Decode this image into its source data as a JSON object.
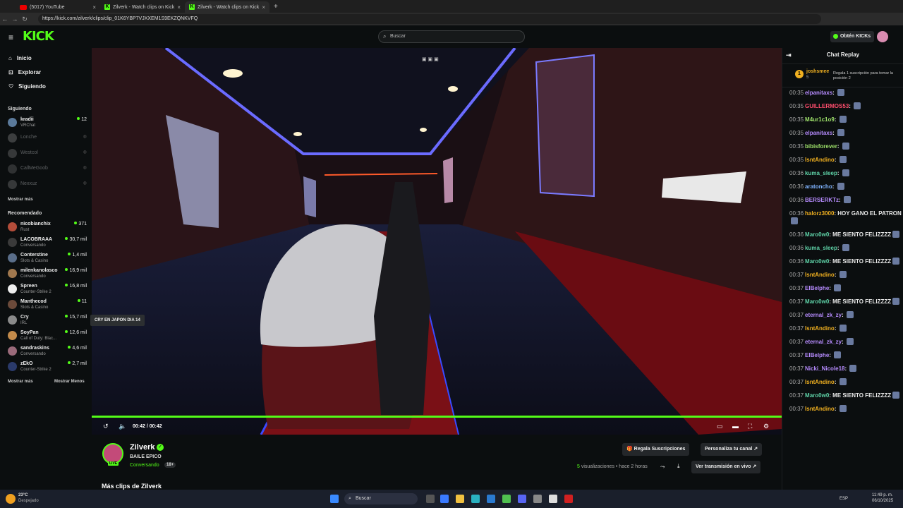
{
  "browser": {
    "tabs": [
      {
        "title": "(5017) YouTube",
        "icon": "youtube-icon"
      },
      {
        "title": "Zilverk - Watch clips on Kick",
        "icon": "kick-icon"
      },
      {
        "title": "Zilverk - Watch clips on Kick",
        "icon": "kick-icon"
      }
    ],
    "url": "https://kick.com/zilverk/clips/clip_01K6YBP7VJXXEM1S9EKZQNKVFQ"
  },
  "topnav": {
    "logo": "KICK",
    "search_placeholder": "Buscar",
    "kicks_button": "Obtén KICKs"
  },
  "sidebar": {
    "main_links": [
      {
        "label": "Inicio",
        "icon": "home-icon"
      },
      {
        "label": "Explorar",
        "icon": "compass-icon"
      },
      {
        "label": "Siguiendo",
        "icon": "heart-icon"
      }
    ],
    "following_title": "Siguiendo",
    "following": [
      {
        "name": "kradii",
        "sub": "VRChat",
        "viewers": "12",
        "online": true,
        "color": "#5b7a9b"
      },
      {
        "name": "Lonche",
        "online": false,
        "color": "#888888"
      },
      {
        "name": "Westcol",
        "online": false,
        "color": "#777777"
      },
      {
        "name": "CallMeGoob",
        "online": false,
        "color": "#666666"
      },
      {
        "name": "Nexxuz",
        "online": false,
        "color": "#777777"
      }
    ],
    "show_more": "Mostrar más",
    "recommended_title": "Recomendado",
    "recommended": [
      {
        "name": "nicobianchix",
        "sub": "Rust",
        "viewers": "371",
        "color": "#b34d3a"
      },
      {
        "name": "LACOBRAAA",
        "sub": "Conversando",
        "viewers": "30,7 mil",
        "color": "#3a3a3a"
      },
      {
        "name": "Conterstine",
        "sub": "Slots & Casino",
        "viewers": "1,4 mil",
        "color": "#5a6e8a"
      },
      {
        "name": "milenkanolasco",
        "sub": "Conversando",
        "viewers": "16,9 mil",
        "color": "#a0784e"
      },
      {
        "name": "Spreen",
        "sub": "Counter-Strike 2",
        "viewers": "16,8 mil",
        "color": "#eeeeee"
      },
      {
        "name": "Manthecod",
        "sub": "Slots & Casino",
        "viewers": "11",
        "color": "#6b4a3a"
      },
      {
        "name": "Cry",
        "sub": "IRL",
        "viewers": "15,7 mil",
        "color": "#8a8a8a"
      },
      {
        "name": "SoyPan",
        "sub": "Call of Duty: Blac...",
        "viewers": "12,6 mil",
        "color": "#c28a4a"
      },
      {
        "name": "sandraskins",
        "sub": "Conversando",
        "viewers": "4,6 mil",
        "color": "#9a6a7a"
      },
      {
        "name": "zEkO",
        "sub": "Counter-Strike 2",
        "viewers": "2,7 mil",
        "color": "#2a3a6a"
      }
    ],
    "show_more_bottom": "Mostrar más",
    "show_less": "Mostrar Menos",
    "tooltip": "CRY EN JAPON DIA 14"
  },
  "player": {
    "time": "00:42 / 00:42",
    "progress": 1.0
  },
  "clip_info": {
    "streamer": "Zilverk",
    "live_badge": "LIVE",
    "title": "BAILE EPICO",
    "category": "Conversando",
    "age_badge": "18+",
    "gift_button": "Regala Suscripciones",
    "customize_button": "Personaliza tu canal",
    "views_count": "5",
    "views_label": "visualizaciones",
    "time_ago": "hace 2 horas",
    "watch_live_button": "Ver transmisión en vivo",
    "more_clips": "Más clips de Zilverk"
  },
  "chat": {
    "title": "Chat Replay",
    "pinned": {
      "rank": "1",
      "user": "joshsmee",
      "sub": "5",
      "text": "Regala 1 suscripción para tomar la posición 2"
    },
    "messages": [
      {
        "ts": "00:35",
        "user": "elpanitaxs",
        "color": "#b78cff",
        "text": ""
      },
      {
        "ts": "00:35",
        "user": "GUILLERMOS53",
        "color": "#ff4d6d",
        "text": ""
      },
      {
        "ts": "00:35",
        "user": "M4ur1c1o9",
        "color": "#9fe36b",
        "text": ""
      },
      {
        "ts": "00:35",
        "user": "elpanitaxs",
        "color": "#b78cff",
        "text": ""
      },
      {
        "ts": "00:35",
        "user": "bibisforever",
        "color": "#9fe36b",
        "text": ""
      },
      {
        "ts": "00:35",
        "user": "IsntAndino",
        "color": "#f0b020",
        "text": ""
      },
      {
        "ts": "00:36",
        "user": "kuma_sleep",
        "color": "#5fd3a8",
        "text": ""
      },
      {
        "ts": "00:36",
        "user": "aratoncho",
        "color": "#7fb3ff",
        "text": ""
      },
      {
        "ts": "00:36",
        "user": "BERSERKTz",
        "color": "#b78cff",
        "text": ""
      },
      {
        "ts": "00:36",
        "user": "halorz3000",
        "color": "#f0b020",
        "text": "HOY GANO EL PATRON"
      },
      {
        "ts": "00:36",
        "user": "Maro0w0",
        "color": "#5fd3a8",
        "text": "ME SIENTO FELIZZZZ"
      },
      {
        "ts": "00:36",
        "user": "kuma_sleep",
        "color": "#5fd3a8",
        "text": ""
      },
      {
        "ts": "00:36",
        "user": "Maro0w0",
        "color": "#5fd3a8",
        "text": "ME SIENTO FELIZZZZ"
      },
      {
        "ts": "00:37",
        "user": "IsntAndino",
        "color": "#f0b020",
        "text": ""
      },
      {
        "ts": "00:37",
        "user": "ElBelphe",
        "color": "#b78cff",
        "text": ""
      },
      {
        "ts": "00:37",
        "user": "Maro0w0",
        "color": "#5fd3a8",
        "text": "ME SIENTO FELIZZZZ"
      },
      {
        "ts": "00:37",
        "user": "eternal_zk_zy",
        "color": "#b78cff",
        "text": ""
      },
      {
        "ts": "00:37",
        "user": "IsntAndino",
        "color": "#f0b020",
        "text": ""
      },
      {
        "ts": "00:37",
        "user": "eternal_zk_zy",
        "color": "#b78cff",
        "text": ""
      },
      {
        "ts": "00:37",
        "user": "ElBelphe",
        "color": "#b78cff",
        "text": ""
      },
      {
        "ts": "00:37",
        "user": "Nicki_Nicole18",
        "color": "#b78cff",
        "text": ""
      },
      {
        "ts": "00:37",
        "user": "IsntAndino",
        "color": "#f0b020",
        "text": ""
      },
      {
        "ts": "00:37",
        "user": "Maro0w0",
        "color": "#5fd3a8",
        "text": "ME SIENTO FELIZZZZ"
      },
      {
        "ts": "00:37",
        "user": "IsntAndino",
        "color": "#f0b020",
        "text": ""
      }
    ]
  },
  "taskbar": {
    "weather_temp": "23°C",
    "weather_desc": "Despejado",
    "search": "Buscar",
    "lang": "ESP",
    "time": "11:49 p. m.",
    "date": "06/10/2025"
  }
}
